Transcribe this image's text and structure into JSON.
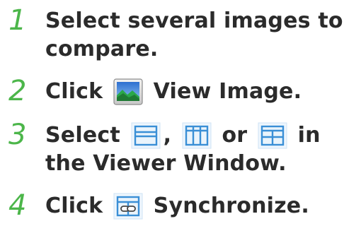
{
  "steps": [
    {
      "number": "1",
      "line1": "Select several images to",
      "line2": "compare."
    },
    {
      "number": "2",
      "before": "Click",
      "icon": "view-image-icon",
      "after": "View Image."
    },
    {
      "number": "3",
      "before": "Select",
      "icon_a": "horizontal-split-icon",
      "sep1": ",",
      "icon_b": "vertical-split-icon",
      "sep2": "or",
      "icon_c": "quad-split-icon",
      "after": "in",
      "line2": "the Viewer Window."
    },
    {
      "number": "4",
      "before": "Click",
      "icon": "synchronize-icon",
      "after": "Synchronize."
    }
  ],
  "colors": {
    "step_number": "#4cb64a",
    "text": "#2b2b2b",
    "icon_blue": "#3a8fd6",
    "icon_bg": "#eaf4fc"
  }
}
